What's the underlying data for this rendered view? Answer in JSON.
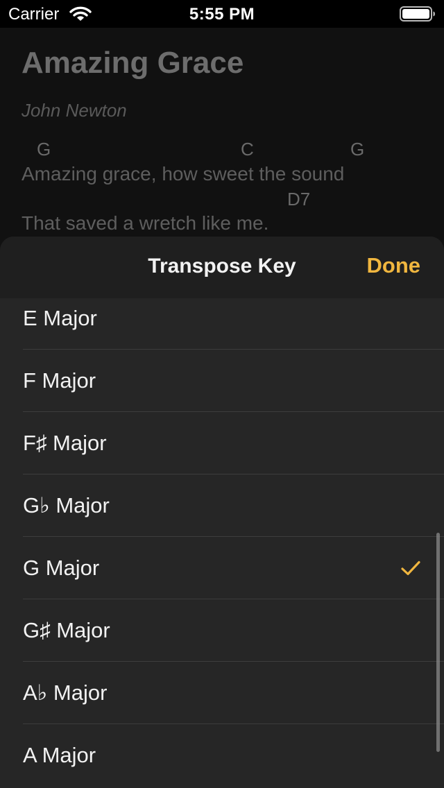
{
  "status_bar": {
    "carrier": "Carrier",
    "time": "5:55 PM",
    "icons": [
      "wifi-icon",
      "battery-icon"
    ]
  },
  "song": {
    "title": "Amazing Grace",
    "author": "John Newton",
    "lines": [
      {
        "chords": [
          "G",
          "C",
          "G"
        ],
        "lyric": "Amazing grace, how sweet the sound"
      },
      {
        "chords": [
          "D7"
        ],
        "lyric": "That saved a wretch like me."
      }
    ]
  },
  "sheet": {
    "title": "Transpose Key",
    "done_label": "Done",
    "accent_color": "#f0b63f",
    "keys": [
      {
        "label": "E Major",
        "selected": false
      },
      {
        "label": "F Major",
        "selected": false
      },
      {
        "label": "F♯ Major",
        "selected": false
      },
      {
        "label": "G♭ Major",
        "selected": false
      },
      {
        "label": "G Major",
        "selected": true
      },
      {
        "label": "G♯ Major",
        "selected": false
      },
      {
        "label": "A♭ Major",
        "selected": false
      },
      {
        "label": "A Major",
        "selected": false
      }
    ],
    "selected_icon": "checkmark-icon"
  }
}
